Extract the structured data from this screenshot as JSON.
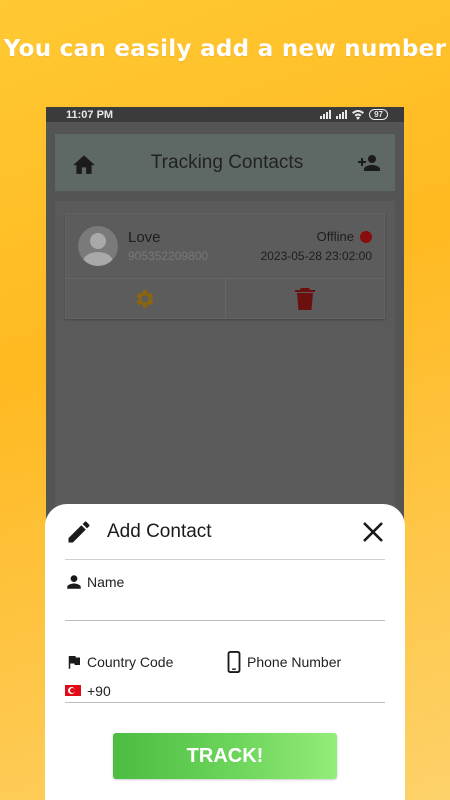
{
  "promo": {
    "headline": "You can easily add a new number"
  },
  "statusbar": {
    "time": "11:07 PM",
    "battery": "97"
  },
  "appbar": {
    "title": "Tracking Contacts",
    "left_icon": "home-icon",
    "right_icon": "add-person-icon"
  },
  "contacts": [
    {
      "name": "Love",
      "number": "905352209800",
      "status": "Offline",
      "last_seen": "2023-05-28 23:02:00"
    }
  ],
  "sheet": {
    "title": "Add Contact",
    "name_label": "Name",
    "name_value": "",
    "country_code_label": "Country Code",
    "country_code_value": "+90",
    "phone_label": "Phone Number",
    "phone_value": "",
    "track_label": "TRACK!"
  },
  "colors": {
    "accent_green": "#4cbc43",
    "offline_red": "#8a0d0d",
    "delete_red": "#c62828",
    "settings_orange": "#f5a623",
    "background_yellow": "#ffc933"
  }
}
